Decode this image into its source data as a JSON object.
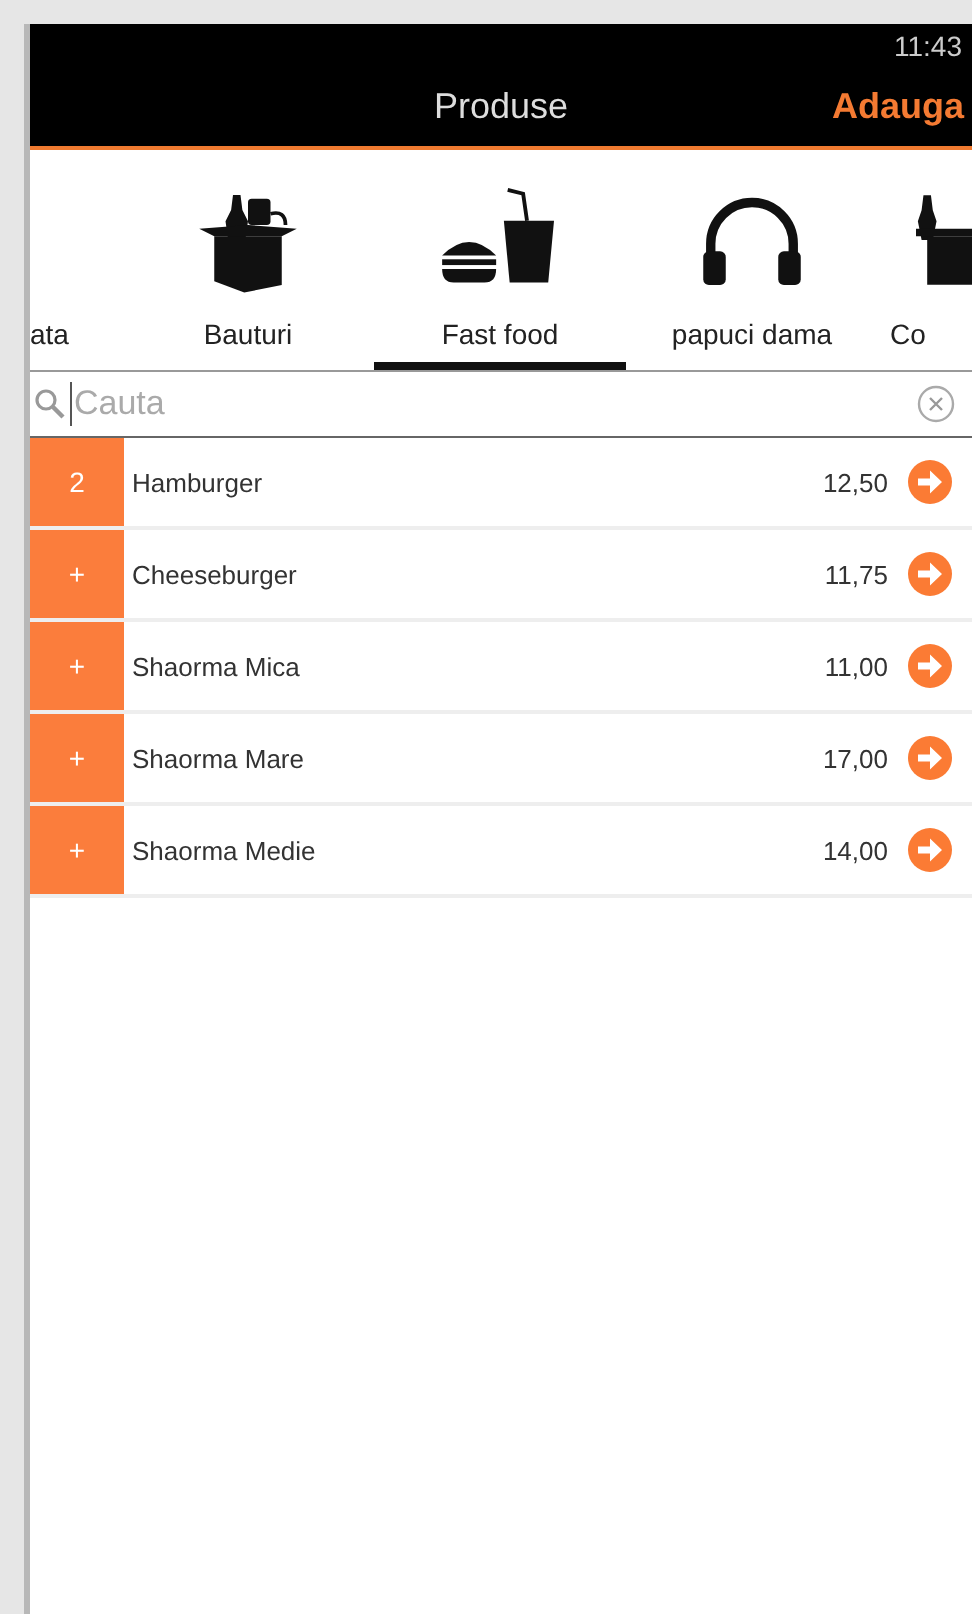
{
  "status_bar": {
    "time": "11:43"
  },
  "header": {
    "title": "Produse",
    "action": "Adauga"
  },
  "categories": [
    {
      "label": "ata",
      "selected": false
    },
    {
      "label": "Bauturi",
      "selected": false
    },
    {
      "label": "Fast food",
      "selected": true
    },
    {
      "label": "papuci dama",
      "selected": false
    },
    {
      "label": "Co",
      "selected": false
    }
  ],
  "search": {
    "placeholder": "Cauta"
  },
  "products": [
    {
      "quantity": "2",
      "name": "Hamburger",
      "price": "12,50"
    },
    {
      "quantity": "+",
      "name": "Cheeseburger",
      "price": "11,75"
    },
    {
      "quantity": "+",
      "name": "Shaorma Mica",
      "price": "11,00"
    },
    {
      "quantity": "+",
      "name": "Shaorma Mare",
      "price": "17,00"
    },
    {
      "quantity": "+",
      "name": "Shaorma Medie",
      "price": "14,00"
    }
  ]
}
